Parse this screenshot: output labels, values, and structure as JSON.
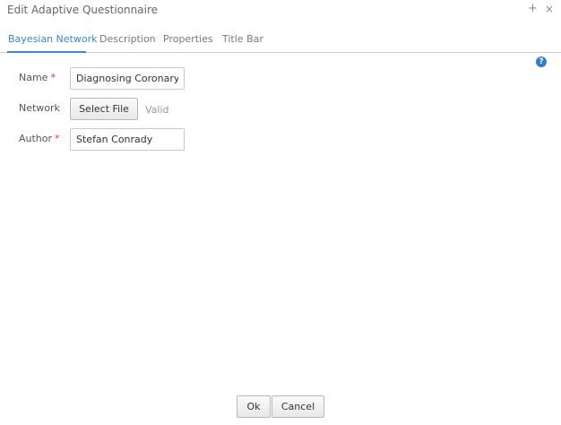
{
  "window": {
    "title": "Edit Adaptive Questionnaire",
    "plus_icon": "+",
    "close_icon": "×"
  },
  "tabs": [
    {
      "label": "Bayesian Network",
      "active": true
    },
    {
      "label": "Description",
      "active": false
    },
    {
      "label": "Properties",
      "active": false
    },
    {
      "label": "Title Bar",
      "active": false
    }
  ],
  "help_icon": "?",
  "form": {
    "name": {
      "label": "Name",
      "required_mark": "*",
      "value": "Diagnosing Coronary"
    },
    "network": {
      "label": "Network",
      "button_label": "Select File",
      "status": "Valid"
    },
    "author": {
      "label": "Author",
      "required_mark": "*",
      "value": "Stefan Conrady"
    }
  },
  "footer": {
    "ok_label": "Ok",
    "cancel_label": "Cancel"
  },
  "colors": {
    "accent": "#3e87c4",
    "required": "#e03c31",
    "help": "#2f7fcf"
  }
}
